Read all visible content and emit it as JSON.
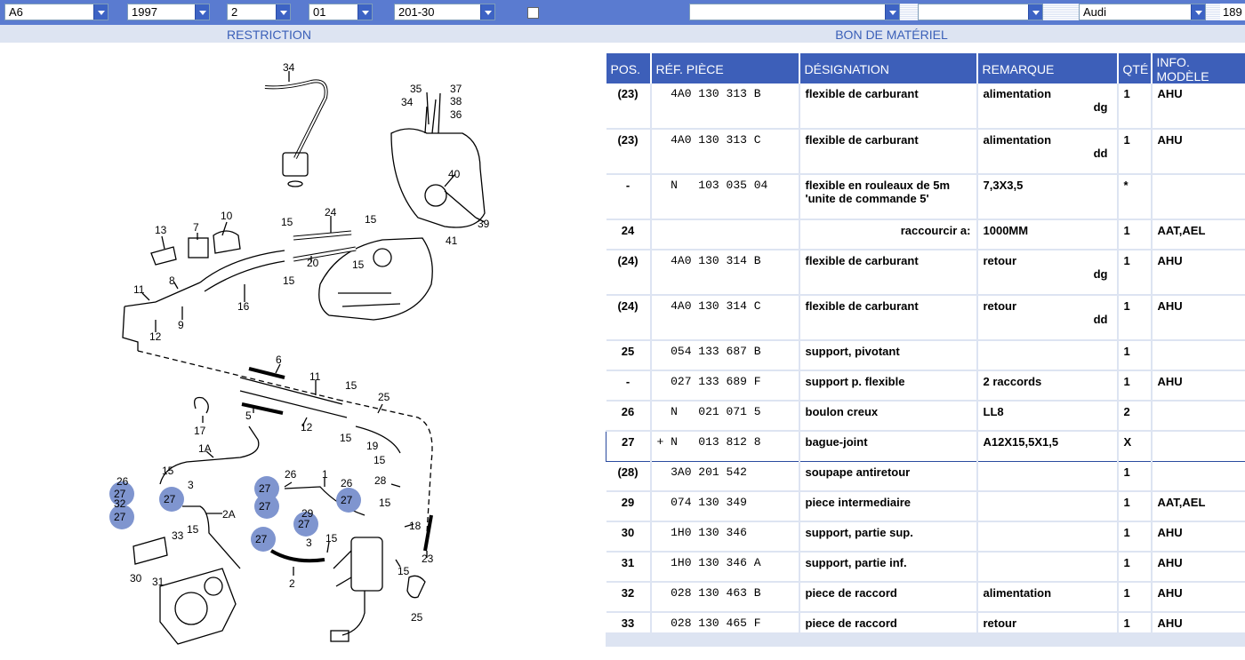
{
  "toolbar": {
    "model": "A6",
    "year": "1997",
    "field3": "2",
    "field4": "01",
    "field5": "201-30",
    "field6": "",
    "field7": "",
    "brand": "Audi",
    "count": "189"
  },
  "sections": {
    "restriction": "RESTRICTION",
    "bom": "BON DE MATÉRIEL"
  },
  "table": {
    "headers": [
      "POS.",
      "RÉF. PIÈCE",
      "DÉSIGNATION",
      "REMARQUE",
      "QTÉ",
      "INFO. MODÈLE"
    ],
    "rows": [
      {
        "pos": "(23)",
        "ref": "  4A0 130 313 B",
        "des": "flexible de carburant",
        "rem": "alimentation",
        "rem2": "dg",
        "qty": "1",
        "info": "AHU"
      },
      {
        "pos": "(23)",
        "ref": "  4A0 130 313 C",
        "des": "flexible de carburant",
        "rem": "alimentation",
        "rem2": "dd",
        "qty": "1",
        "info": "AHU"
      },
      {
        "pos": "-",
        "ref": "  N   103 035 04",
        "des": "flexible en rouleaux de 5m 'unite de commande 5'",
        "rem": "7,3X3,5",
        "rem2": "",
        "qty": "*",
        "info": ""
      },
      {
        "pos": "24",
        "ref": "",
        "des": "raccourcir a:",
        "rem": "1000MM",
        "rem2": "",
        "qty": "1",
        "info": "AAT,AEL"
      },
      {
        "pos": "(24)",
        "ref": "  4A0 130 314 B",
        "des": "flexible de carburant",
        "rem": "retour",
        "rem2": "dg",
        "qty": "1",
        "info": "AHU"
      },
      {
        "pos": "(24)",
        "ref": "  4A0 130 314 C",
        "des": "flexible de carburant",
        "rem": "retour",
        "rem2": "dd",
        "qty": "1",
        "info": "AHU"
      },
      {
        "pos": "25",
        "ref": "  054 133 687 B",
        "des": "support, pivotant",
        "rem": "",
        "rem2": "",
        "qty": "1",
        "info": ""
      },
      {
        "pos": "-",
        "ref": "  027 133 689 F",
        "des": "support p. flexible",
        "rem": "2 raccords",
        "rem2": "",
        "qty": "1",
        "info": "AHU"
      },
      {
        "pos": "26",
        "ref": "  N   021 071 5",
        "des": "boulon creux",
        "rem": "LL8",
        "rem2": "",
        "qty": "2",
        "info": ""
      },
      {
        "pos": "27",
        "ref": "+ N   013 812 8",
        "des": "bague-joint",
        "rem": "A12X15,5X1,5",
        "rem2": "",
        "qty": "X",
        "info": ""
      },
      {
        "pos": "(28)",
        "ref": "  3A0 201 542",
        "des": "soupape antiretour",
        "rem": "",
        "rem2": "",
        "qty": "1",
        "info": ""
      },
      {
        "pos": "29",
        "ref": "  074 130 349",
        "des": "piece intermediaire",
        "rem": "",
        "rem2": "",
        "qty": "1",
        "info": "AAT,AEL"
      },
      {
        "pos": "30",
        "ref": "  1H0 130 346",
        "des": "support, partie sup.",
        "rem": "",
        "rem2": "",
        "qty": "1",
        "info": "AHU"
      },
      {
        "pos": "31",
        "ref": "  1H0 130 346 A",
        "des": "support, partie inf.",
        "rem": "",
        "rem2": "",
        "qty": "1",
        "info": "AHU"
      },
      {
        "pos": "32",
        "ref": "  028 130 463 B",
        "des": "piece de raccord",
        "rem": "alimentation",
        "rem2": "",
        "qty": "1",
        "info": "AHU"
      },
      {
        "pos": "33",
        "ref": "  028 130 465 F",
        "des": "piece de raccord",
        "rem": "retour",
        "rem2": "",
        "qty": "1",
        "info": "AHU"
      }
    ]
  },
  "diagram": {
    "labels": [
      "34",
      "35",
      "37",
      "38",
      "36",
      "40",
      "39",
      "41",
      "10",
      "13",
      "7",
      "24",
      "15",
      "8",
      "11",
      "12",
      "9",
      "16",
      "20",
      "6",
      "11",
      "15",
      "25",
      "5",
      "12",
      "17",
      "1A",
      "2A",
      "26",
      "27",
      "32",
      "27",
      "3",
      "33",
      "15",
      "30",
      "31",
      "1",
      "28",
      "15",
      "23",
      "18",
      "29",
      "2",
      "25"
    ],
    "highlighted": [
      "27",
      "27",
      "27",
      "27",
      "27",
      "27",
      "27",
      "27"
    ]
  },
  "colors": {
    "toolbar": "#5a7bd0",
    "header": "#3d5fb9",
    "section": "#dde4f2",
    "highlight": "#7f95cf"
  }
}
